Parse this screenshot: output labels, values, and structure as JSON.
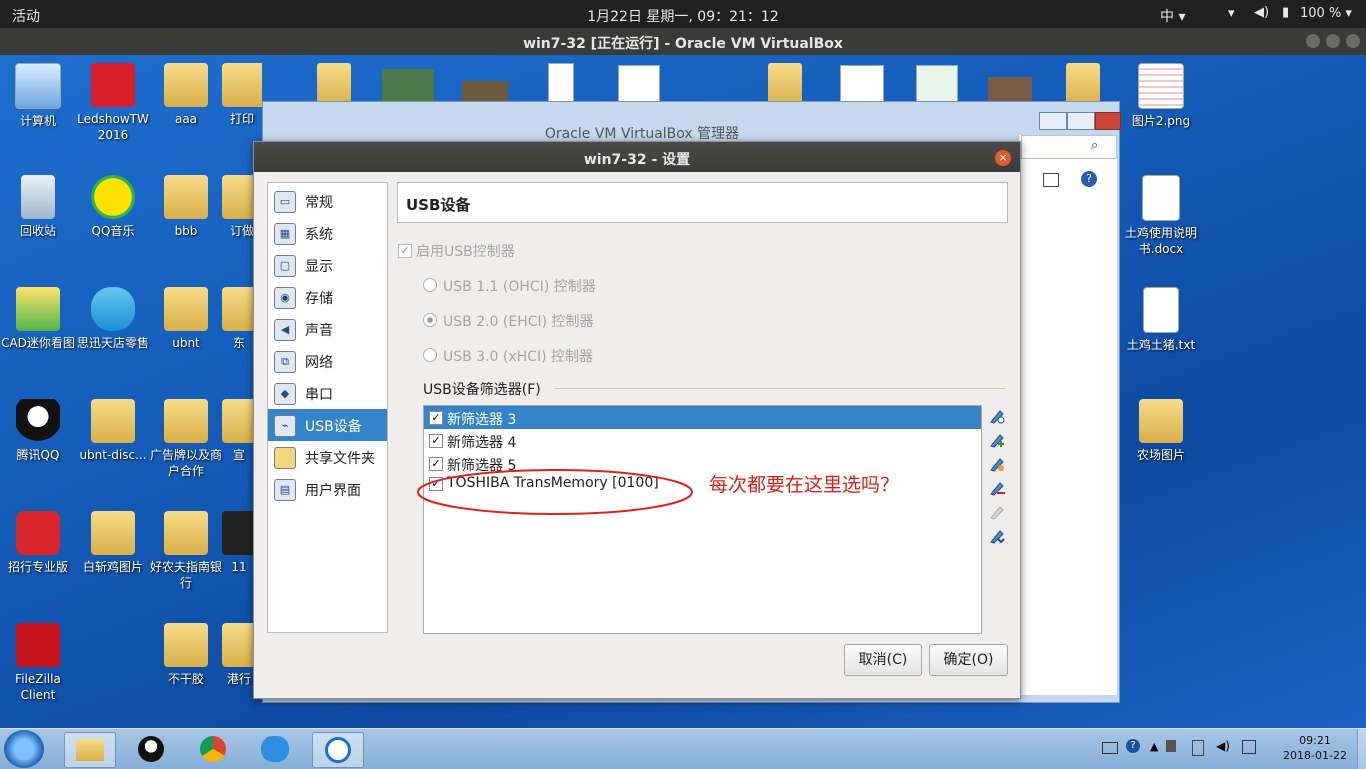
{
  "topbar": {
    "activities": "活动",
    "clock": "1月22日 星期一, 09：21：12",
    "ime": "中 ▾",
    "battery": "100 % ▾"
  },
  "vm_window": {
    "title": "win7-32 [正在运行] - Oracle VM VirtualBox"
  },
  "desktop": {
    "icons": [
      {
        "label": "计算机"
      },
      {
        "label": "LedshowTW 2016"
      },
      {
        "label": "aaa"
      },
      {
        "label": "打印"
      },
      {
        "label": "回收站"
      },
      {
        "label": "QQ音乐"
      },
      {
        "label": "bbb"
      },
      {
        "label": "订做"
      },
      {
        "label": "CAD迷你看图"
      },
      {
        "label": "思迅天店零售"
      },
      {
        "label": "ubnt"
      },
      {
        "label": "东"
      },
      {
        "label": "腾讯QQ"
      },
      {
        "label": "ubnt-disc..."
      },
      {
        "label": "广告牌以及商户合作"
      },
      {
        "label": "宣"
      },
      {
        "label": "招行专业版"
      },
      {
        "label": "白斩鸡图片"
      },
      {
        "label": "好农夫指南银行"
      },
      {
        "label": "11"
      },
      {
        "label": "FileZilla Client"
      },
      {
        "label": "不干胶"
      },
      {
        "label": "港行"
      },
      {
        "label": "图片2.png"
      },
      {
        "label": "土鸡使用说明书.docx"
      },
      {
        "label": "土鸡土猪.txt"
      },
      {
        "label": "农场图片"
      }
    ]
  },
  "manager": {
    "title": "Oracle VM VirtualBox 管理器"
  },
  "dialog": {
    "title": "win7-32 - 设置",
    "close": "×",
    "nav": [
      {
        "label": "常规"
      },
      {
        "label": "系统"
      },
      {
        "label": "显示"
      },
      {
        "label": "存储"
      },
      {
        "label": "声音"
      },
      {
        "label": "网络"
      },
      {
        "label": "串口"
      },
      {
        "label": "USB设备"
      },
      {
        "label": "共享文件夹"
      },
      {
        "label": "用户界面"
      }
    ],
    "section_title": "USB设备",
    "enable_usb": "启用USB控制器",
    "usb_options": [
      {
        "label": "USB 1.1 (OHCI) 控制器",
        "selected": false
      },
      {
        "label": "USB 2.0 (EHCI) 控制器",
        "selected": true
      },
      {
        "label": "USB 3.0 (xHCI) 控制器",
        "selected": false
      }
    ],
    "filters_label": "USB设备筛选器(F)",
    "filters": [
      {
        "label": "新筛选器 3",
        "checked": true,
        "selected": true
      },
      {
        "label": "新筛选器 4",
        "checked": true,
        "selected": false
      },
      {
        "label": "新筛选器 5",
        "checked": true,
        "selected": false
      },
      {
        "label": "TOSHIBA TransMemory [0100]",
        "checked": true,
        "selected": false
      }
    ],
    "cancel": "取消(C)",
    "ok": "确定(O)"
  },
  "annotation": {
    "text": "每次都要在这里选吗？",
    "color": "#e0201b"
  },
  "taskbar": {
    "time": "09:21",
    "date": "2018-01-22"
  },
  "colors": {
    "selection": "#3584c9",
    "annotation": "#e0201b"
  }
}
